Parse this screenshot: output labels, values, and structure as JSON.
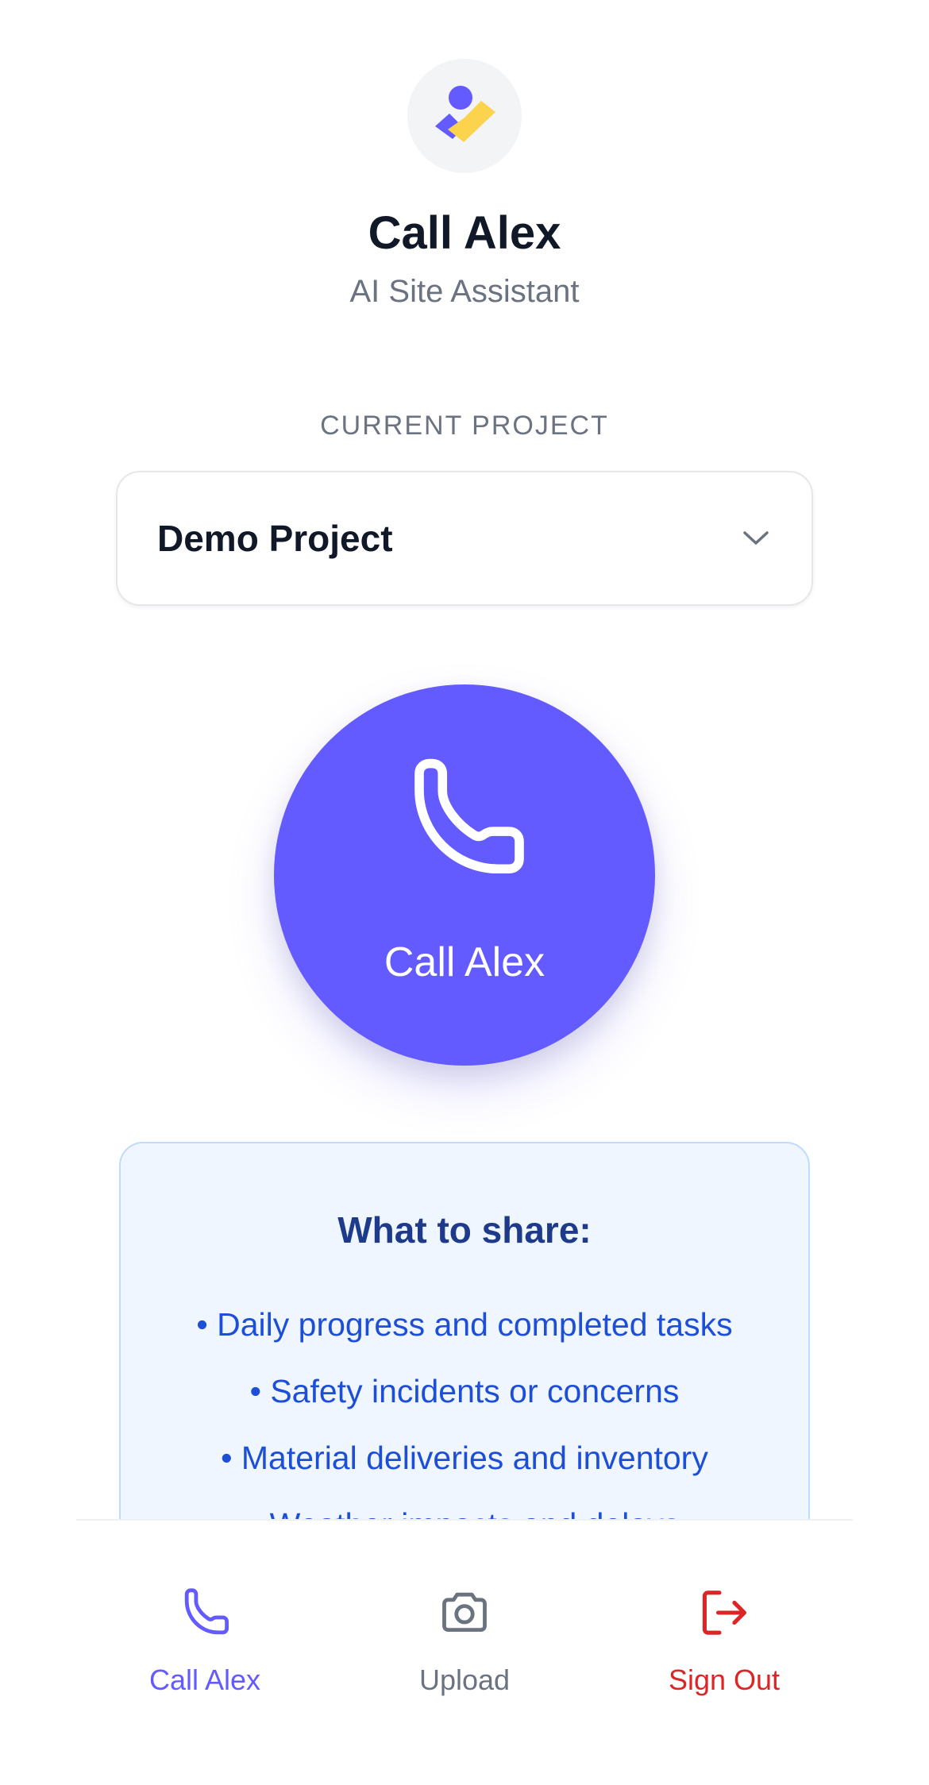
{
  "header": {
    "logo": "assistant-logo-icon",
    "title": "Call Alex",
    "subtitle": "AI Site Assistant"
  },
  "project": {
    "label": "CURRENT PROJECT",
    "selected": "Demo Project"
  },
  "call_button": {
    "icon": "phone-icon",
    "label": "Call Alex"
  },
  "info": {
    "heading": "What to share:",
    "items": [
      "• Daily progress and completed tasks",
      "• Safety incidents or concerns",
      "• Material deliveries and inventory",
      "• Weather impacts and delays"
    ]
  },
  "nav": {
    "items": [
      {
        "label": "Call Alex",
        "icon": "phone-icon",
        "color": "#635bff"
      },
      {
        "label": "Upload",
        "icon": "camera-icon",
        "color": "#6b7280"
      },
      {
        "label": "Sign Out",
        "icon": "sign-out-icon",
        "color": "#dc2626"
      }
    ]
  },
  "colors": {
    "accent": "#635bff",
    "logo_yellow": "#fcd34d",
    "danger": "#dc2626",
    "info_bg": "#eff6ff",
    "info_text": "#1d4ed8"
  }
}
